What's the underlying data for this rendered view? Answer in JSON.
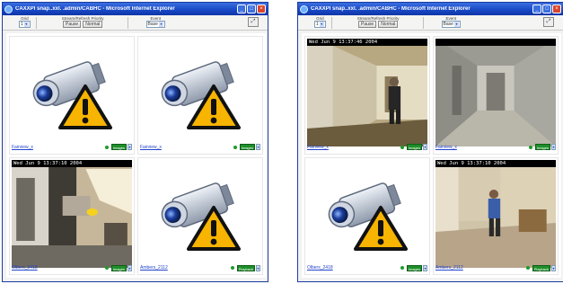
{
  "windows": [
    {
      "title": "CAXXPI  snap..xxl. .admin/CABHC - Microsoft Internet Explorer",
      "toolbar": {
        "grid_label": "Grid",
        "grid_value": "1",
        "stream_group_label": "Stream/Refresh Priority",
        "pause_label": "Pause",
        "normal_label": "Normal",
        "event_label": "Event",
        "event_value": "Base"
      },
      "cells": [
        {
          "name": "Fairview_x",
          "status": "online",
          "stream": "Images",
          "feed": "offline",
          "stamp": ""
        },
        {
          "name": "Fairview_x",
          "status": "online",
          "stream": "Images",
          "feed": "offline",
          "stamp": ""
        },
        {
          "name": "Olbers_2418",
          "status": "online",
          "stream": "Images",
          "feed": "office",
          "stamp": "Wed Jun  9 13:37:10 2004"
        },
        {
          "name": "Ambers_2112",
          "status": "online",
          "stream": "Playback",
          "feed": "offline",
          "stamp": ""
        }
      ]
    },
    {
      "title": "CAXXPI  snap..xxl. .admin/CABHC - Microsoft Internet Explorer",
      "toolbar": {
        "grid_label": "Grid",
        "grid_value": "1",
        "stream_group_label": "Stream/Refresh Priority",
        "pause_label": "Pause",
        "normal_label": "Normal",
        "event_label": "Event",
        "event_value": "Base"
      },
      "cells": [
        {
          "name": "Fairview_x",
          "status": "online",
          "stream": "Images",
          "feed": "hall",
          "stamp": "Wed Jun  9 13:37:46 2004"
        },
        {
          "name": "Fairview_x",
          "status": "online",
          "stream": "Images",
          "feed": "corridor",
          "stamp": ""
        },
        {
          "name": "Olbers_2418",
          "status": "online",
          "stream": "Images",
          "feed": "offline",
          "stamp": ""
        },
        {
          "name": "Ambers_2112",
          "status": "online",
          "stream": "Playback",
          "feed": "lobby",
          "stamp": "Wed Jun  9 13:37:10 2004"
        }
      ]
    }
  ],
  "colors": {
    "titlebar": "#1747c4",
    "status_online": "#1f9a2a",
    "link": "#2244cc",
    "warning": "#f7b400"
  },
  "icons": {
    "offline": "camera-warning-icon",
    "status": "status-dot-icon",
    "fullscreen": "fullscreen-icon"
  }
}
